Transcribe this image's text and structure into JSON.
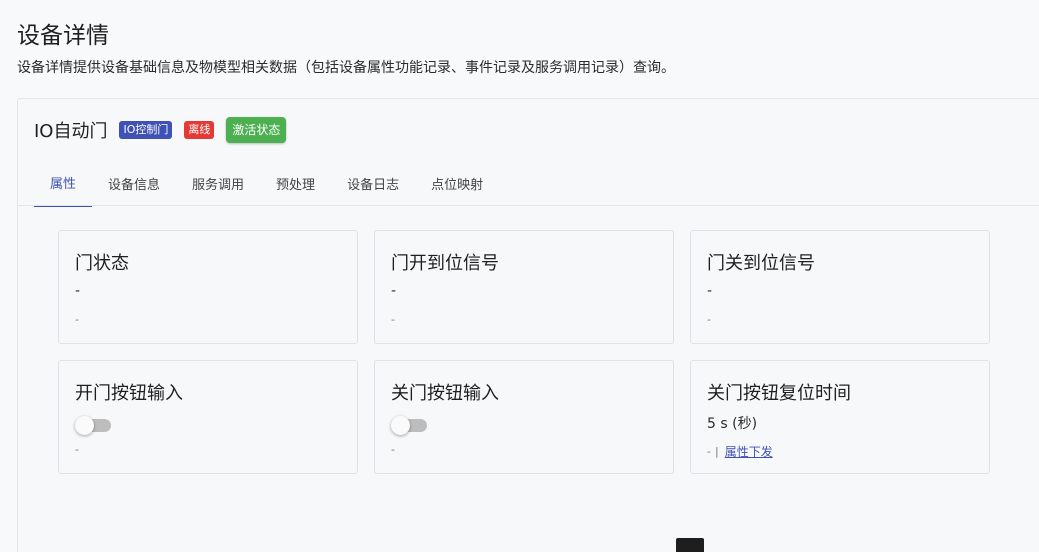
{
  "page": {
    "title": "设备详情",
    "description": "设备详情提供设备基础信息及物模型相关数据（包括设备属性功能记录、事件记录及服务调用记录）查询。"
  },
  "device": {
    "name": "IO自动门",
    "chips": {
      "type": "IO控制门",
      "online_status": "离线",
      "activation": "激活状态"
    }
  },
  "colors": {
    "accent": "#3f51b5",
    "offline": "#e53935",
    "activated": "#4caf50"
  },
  "tabs": [
    "属性",
    "设备信息",
    "服务调用",
    "预处理",
    "设备日志",
    "点位映射"
  ],
  "active_tab": "属性",
  "properties": [
    {
      "name": "门状态",
      "value": "-",
      "footer": "-"
    },
    {
      "name": "门开到位信号",
      "value": "-",
      "footer": "-"
    },
    {
      "name": "门关到位信号",
      "value": "-",
      "footer": "-"
    },
    {
      "name": "开门按钮输入",
      "toggle_on": false,
      "footer": "-"
    },
    {
      "name": "关门按钮输入",
      "toggle_on": false,
      "footer": "-"
    },
    {
      "name": "关门按钮复位时间",
      "value": "5 s (秒)",
      "footer": "-",
      "separator": "|",
      "action": "属性下发"
    }
  ]
}
